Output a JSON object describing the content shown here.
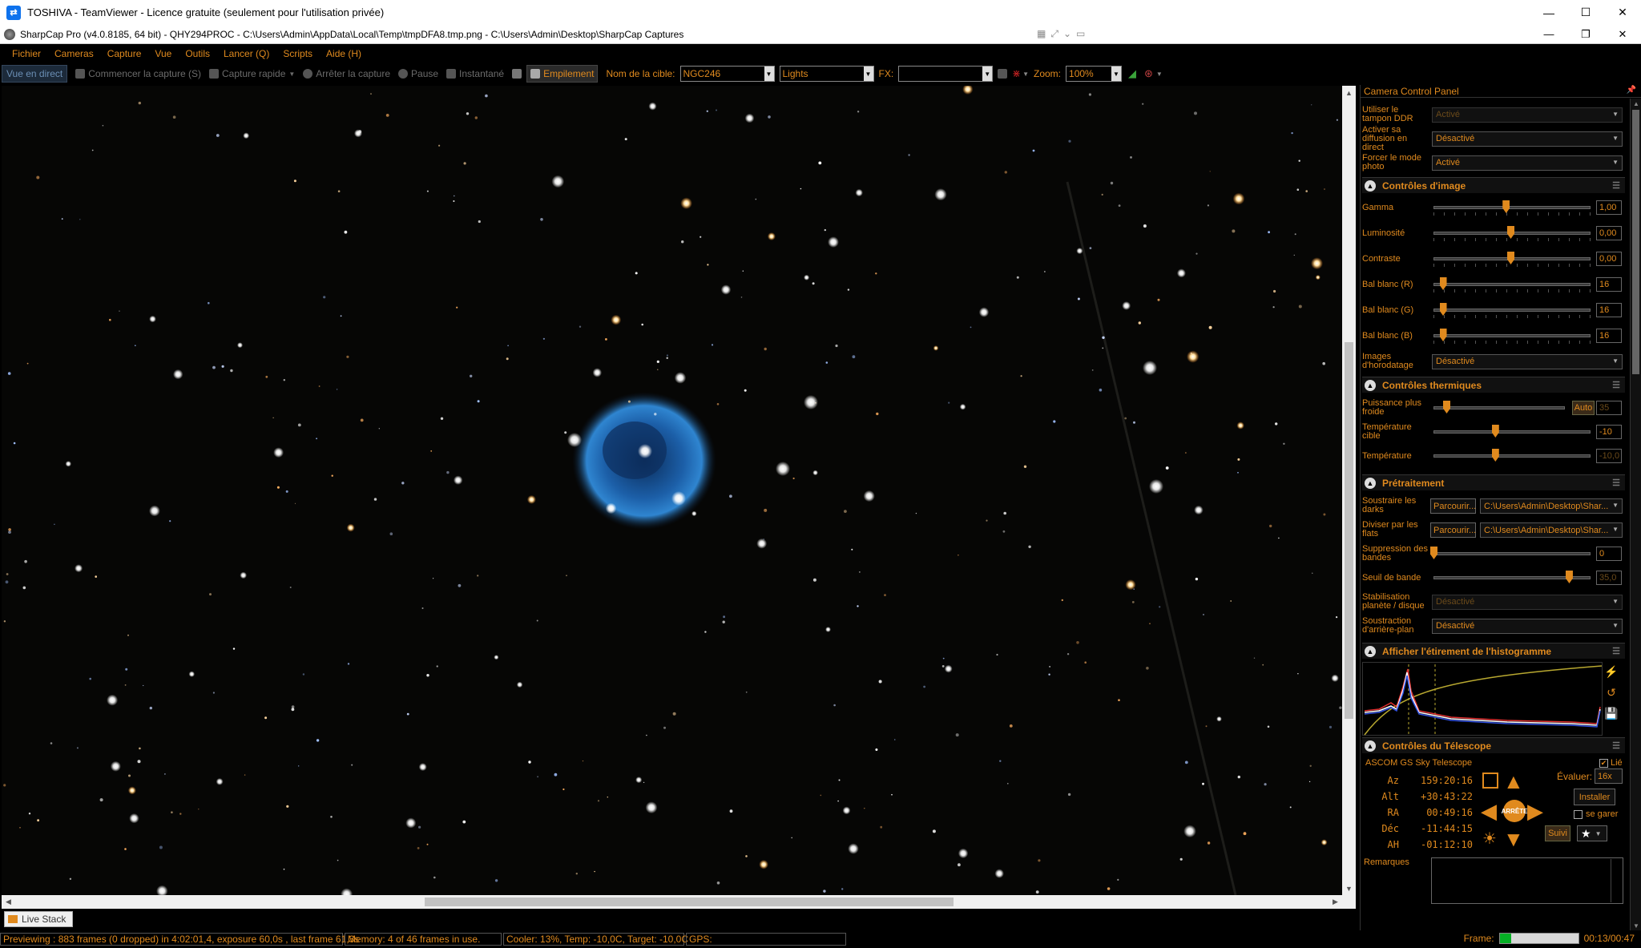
{
  "teamviewer": {
    "title": "TOSHIVA - TeamViewer - Licence gratuite (seulement pour l'utilisation privée)",
    "minimize": "—",
    "maximize": "☐",
    "close": "✕"
  },
  "sharpcap": {
    "title": "SharpCap Pro (v4.0.8185, 64 bit) - QHY294PROC - C:\\Users\\Admin\\AppData\\Local\\Temp\\tmpDFA8.tmp.png - C:\\Users\\Admin\\Desktop\\SharpCap Captures",
    "minimize": "—",
    "restore": "❐",
    "close": "✕"
  },
  "menu": [
    "Fichier",
    "Cameras",
    "Capture",
    "Vue",
    "Outils",
    "Lancer (Q)",
    "Scripts",
    "Aide (H)"
  ],
  "toolbar": {
    "live_view": "Vue en direct",
    "start_capture": "Commencer la capture (S)",
    "quick_capture": "Capture rapide",
    "stop_capture": "Arrêter la capture",
    "pause": "Pause",
    "snapshot": "Instantané",
    "stacking": "Empilement",
    "target_label": "Nom de la cible:",
    "target_value": "NGC246",
    "frame_type": "Lights",
    "fx_label": "FX:",
    "fx_value": "",
    "zoom_label": "Zoom:",
    "zoom_value": "100%"
  },
  "livestack_tab": "Live Stack",
  "status": {
    "preview": "Previewing : 883 frames (0 dropped) in 4:02:01,4, exposure 60,0s , last frame 61,3s",
    "memory": "Memory: 4 of 46 frames in use.",
    "cooler": "Cooler: 13%, Temp: -10,0C, Target: -10,0C",
    "gps": "GPS:",
    "frame_label": "Frame:",
    "frame_progress": 0.15,
    "elapsed": "00:13/00:47"
  },
  "panel": {
    "title": "Camera Control Panel",
    "top_rows": [
      {
        "label": "Utiliser le tampon DDR",
        "value": "Activé",
        "dim": true
      },
      {
        "label": "Activer sa diffusion en direct",
        "value": "Désactivé",
        "dim": false
      },
      {
        "label": "Forcer le mode photo",
        "value": "Activé",
        "dim": false
      }
    ],
    "image_controls": {
      "header": "Contrôles d'image",
      "sliders": [
        {
          "label": "Gamma",
          "value": "1,00",
          "pos": 0.47
        },
        {
          "label": "Luminosité",
          "value": "0,00",
          "pos": 0.5
        },
        {
          "label": "Contraste",
          "value": "0,00",
          "pos": 0.5
        },
        {
          "label": "Bal blanc (R)",
          "value": "16",
          "pos": 0.06
        },
        {
          "label": "Bal blanc (G)",
          "value": "16",
          "pos": 0.06
        },
        {
          "label": "Bal blanc (B)",
          "value": "16",
          "pos": 0.06
        }
      ],
      "timestamp_label": "Images d'horodatage",
      "timestamp_value": "Désactivé"
    },
    "thermal": {
      "header": "Contrôles thermiques",
      "cooler_label": "Puissance plus froide",
      "cooler_auto": "Auto",
      "cooler_value": "35",
      "cooler_pos": 0.1,
      "target_label": "Température cible",
      "target_value": "-10",
      "target_pos": 0.4,
      "temp_label": "Température",
      "temp_value": "-10,0",
      "temp_pos": 0.4
    },
    "preprocessing": {
      "header": "Prétraitement",
      "darks_label": "Soustraire les darks",
      "darks_browse": "Parcourir...",
      "darks_path": "C:\\Users\\Admin\\Desktop\\Shar...",
      "flats_label": "Diviser par les flats",
      "flats_browse": "Parcourir...",
      "flats_path": "C:\\Users\\Admin\\Desktop\\Shar...",
      "banding_label": "Suppression des bandes",
      "banding_value": "0",
      "banding_pos": 0.0,
      "threshold_label": "Seuil de bande",
      "threshold_value": "35,0",
      "threshold_pos": 0.88,
      "stabilization_label": "Stabilisation planète / disque",
      "stabilization_value": "Désactivé",
      "background_label": "Soustraction d'arrière-plan",
      "background_value": "Désactivé"
    },
    "histogram": {
      "header": "Afficher l'étirement de l'histogramme"
    },
    "telescope": {
      "header": "Contrôles du Télescope",
      "name": "ASCOM GS Sky Telescope",
      "linked_label": "Lié",
      "coords": [
        {
          "k": "Az",
          "v": "159:20:16"
        },
        {
          "k": "Alt",
          "v": "+30:43:22"
        },
        {
          "k": "RA",
          "v": "00:49:16"
        },
        {
          "k": "Déc",
          "v": "-11:44:15"
        },
        {
          "k": "AH",
          "v": "-01:12:10"
        }
      ],
      "rate_label": "Évaluer:",
      "rate_value": "16x",
      "install": "Installer",
      "park": "se garer",
      "track": "Suivi",
      "stop": "ARRÊTE"
    },
    "remarks_label": "Remarques"
  }
}
